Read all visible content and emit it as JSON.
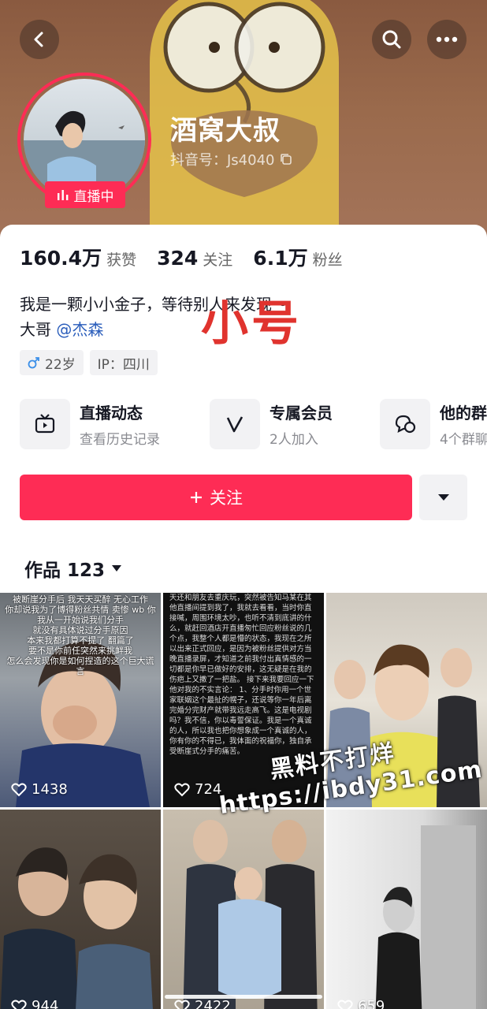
{
  "header": {
    "name": "酒窝大叔",
    "douyin_id": "抖音号：Js4040",
    "live_badge": "直播中"
  },
  "stats": [
    {
      "num": "160.4万",
      "label": "获赞"
    },
    {
      "num": "324",
      "label": "关注"
    },
    {
      "num": "6.1万",
      "label": "粉丝"
    }
  ],
  "bio": {
    "line1": "我是一颗小小金子，等待别人来发现～",
    "line2_prefix": "大哥",
    "mention": "@杰森"
  },
  "overlay_text": "小号",
  "tags": {
    "age": "22岁",
    "ip": "IP：四川"
  },
  "features": [
    {
      "title": "直播动态",
      "sub": "查看历史记录",
      "icon": "tv-icon"
    },
    {
      "title": "专属会员",
      "sub": "2人加入",
      "icon": "v-icon"
    },
    {
      "title": "他的群",
      "sub": "4个群聊",
      "icon": "chat-icon"
    }
  ],
  "follow_label": "关注",
  "works_label": "作品 123",
  "posts": [
    {
      "likes": "1438",
      "caption": "被断崖分手后 我天天买醉 无心工作\n你却说我为了博得粉丝共情 卖惨 wb 你\n我从一开始说我们分手\n就没有具体说过分手原因\n本来我都打算不提了 翻篇了\n要不是你前任突然来挑衅我\n怎么会发现你是如何捏造的这个巨大谎言"
    },
    {
      "likes": "724",
      "caption": "天还和朋友去重庆玩，突然被告知马某在其他直播间提到我了，我就去看看，当时你直接喊，周围环境太吵，也听不清到底讲的什么，就赶回酒店开直播匆忙回应粉丝说的几个点，我整个人都是懵的状态，我现在之所以出来正式回应，是因为被粉丝提供对方当晚直播录屏，才知道之前我付出真情感的一切都是你早已做好的安排，这无疑是在我的伤疤上又撒了一把盐。\n接下来我要回应一下他对我的不实言论：\n1、分手时你用一个世家联姻这个最扯的幌子，还说等你一年后离完婚分完财产就带我远走高飞。这是电视剧吗？我不信，你以毒誓保证。我是一个真诚的人，所以我也把你想象成一个真诚的人，你有你的不得已，我体面的祝福你，独自承受断崖式分手的痛苦。"
    },
    {
      "likes": "",
      "caption": ""
    },
    {
      "likes": "944",
      "caption": ""
    },
    {
      "likes": "2422",
      "caption": ""
    },
    {
      "likes": "659",
      "caption": ""
    }
  ],
  "site_watermark": {
    "line1": "黑料不打烊",
    "line2": "https://ibdy31.com"
  },
  "colors": {
    "accent": "#fe2c55",
    "mention": "#2a5dbb",
    "overlay_red": "#e0332e"
  }
}
